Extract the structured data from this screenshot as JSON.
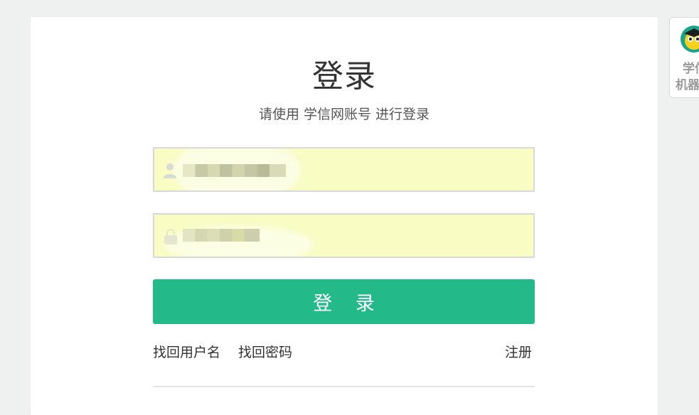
{
  "login": {
    "title": "登录",
    "subtitle": "请使用 学信网账号 进行登录",
    "username_value": "",
    "password_value": "",
    "submit_label": "登 录"
  },
  "links": {
    "find_username": "找回用户名",
    "find_password": "找回密码",
    "register": "注册"
  },
  "robot": {
    "line1": "学信",
    "line2": "机器人"
  },
  "colors": {
    "primary_button": "#23b988",
    "autofill_background": "#f9fcc3",
    "page_background": "#eef1f0"
  },
  "icons": [
    "user-icon",
    "lock-icon",
    "robot-avatar-icon"
  ]
}
